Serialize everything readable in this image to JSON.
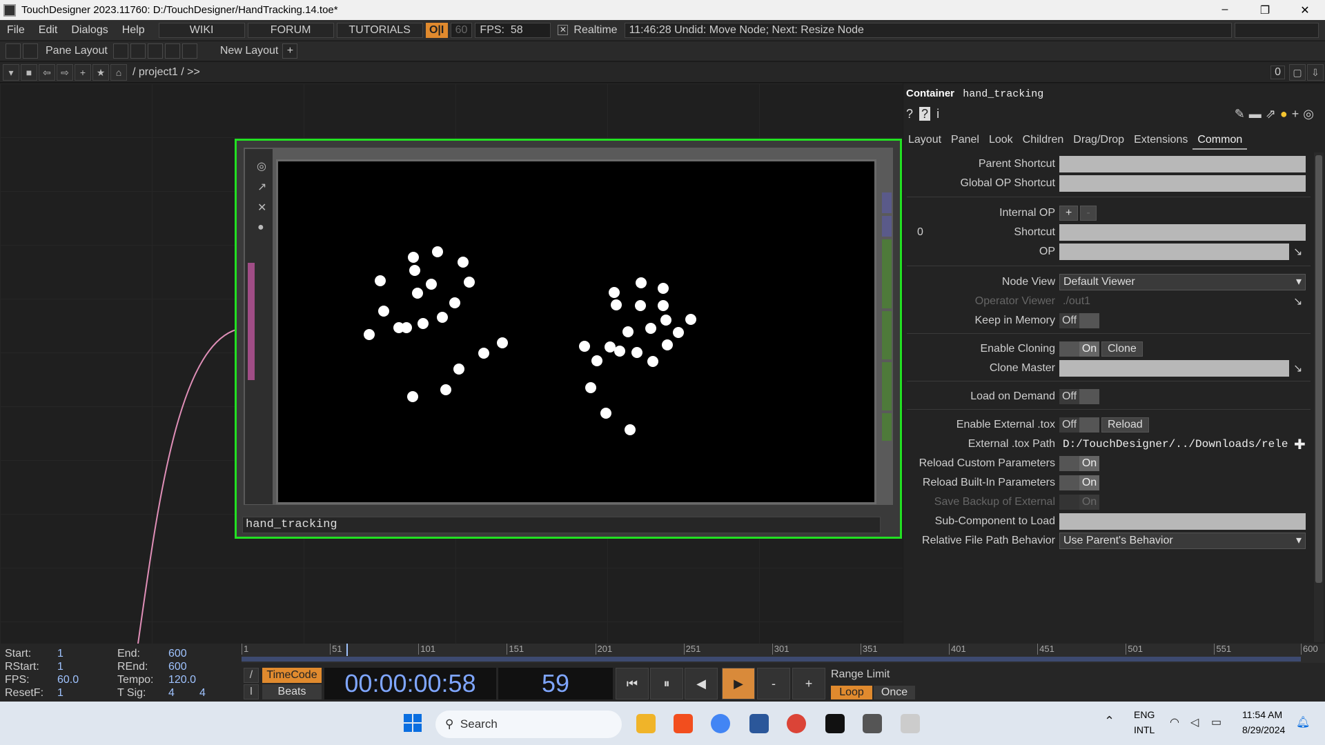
{
  "window": {
    "title": "TouchDesigner 2023.11760: D:/TouchDesigner/HandTracking.14.toe*",
    "minimize": "–",
    "maximize": "❐",
    "close": "✕"
  },
  "menubar": {
    "items": [
      "File",
      "Edit",
      "Dialogs",
      "Help"
    ],
    "links": [
      "WIKI",
      "FORUM",
      "TUTORIALS"
    ],
    "oi": "O|I",
    "fps_cap": "60",
    "fps_label": "FPS:",
    "fps_value": "58",
    "realtime_check": "✕",
    "realtime": "Realtime",
    "status": "11:46:28 Undid: Move Node; Next: Resize Node"
  },
  "panebar": {
    "pane_layout": "Pane Layout",
    "new_layout": "New Layout",
    "plus": "+",
    "pane_count": "0"
  },
  "pathbar": {
    "path": "/ project1 / >>"
  },
  "node": {
    "name": "hand_tracking"
  },
  "params": {
    "op_type": "Container",
    "op_name": "hand_tracking",
    "tabs": [
      "Layout",
      "Panel",
      "Look",
      "Children",
      "Drag/Drop",
      "Extensions",
      "Common"
    ],
    "active_tab": "Common",
    "rows": {
      "parent_shortcut": "Parent Shortcut",
      "global_op_shortcut": "Global OP Shortcut",
      "internal_op": "Internal OP",
      "internal_index": "0",
      "shortcut": "Shortcut",
      "op": "OP",
      "node_view": "Node View",
      "node_view_value": "Default Viewer",
      "operator_viewer": "Operator Viewer",
      "operator_viewer_value": "./out1",
      "keep_in_memory": "Keep in Memory",
      "enable_cloning": "Enable Cloning",
      "clone_btn": "Clone",
      "clone_master": "Clone Master",
      "load_on_demand": "Load on Demand",
      "enable_external": "Enable External .tox",
      "reload_btn": "Reload",
      "external_path": "External .tox Path",
      "external_path_value": "D:/TouchDesigner/../Downloads/rele",
      "reload_custom": "Reload Custom Parameters",
      "reload_builtin": "Reload Built-In Parameters",
      "save_backup": "Save Backup of External",
      "sub_component": "Sub-Component to Load",
      "relative_path": "Relative File Path Behavior",
      "relative_path_value": "Use Parent's Behavior",
      "off": "Off",
      "on": "On"
    }
  },
  "timeline": {
    "start_label": "Start:",
    "start": "1",
    "rstart_label": "RStart:",
    "rstart": "1",
    "fps_label": "FPS:",
    "fps": "60.0",
    "resetf_label": "ResetF:",
    "resetf": "1",
    "end_label": "End:",
    "end": "600",
    "rend_label": "REnd:",
    "rend": "600",
    "tempo_label": "Tempo:",
    "tempo": "120.0",
    "tsig_label": "T Sig:",
    "tsig_a": "4",
    "tsig_b": "4",
    "ticks": [
      "1",
      "51",
      "101",
      "151",
      "201",
      "251",
      "301",
      "351",
      "401",
      "451",
      "501",
      "551",
      "600"
    ],
    "timecode_btn": "TimeCode",
    "beats_btn": "Beats",
    "timecode": "00:00:00:58",
    "frame": "59",
    "range_limit": "Range Limit",
    "loop": "Loop",
    "once": "Once",
    "minus": "-",
    "plus": "+"
  },
  "taskbar": {
    "search": "Search",
    "lang1": "ENG",
    "lang2": "INTL",
    "time": "11:54 AM",
    "date": "8/29/2024"
  },
  "colors": {
    "node_border": "#22e022",
    "accent": "#e08a2e",
    "timecode": "#7fa6ff"
  }
}
